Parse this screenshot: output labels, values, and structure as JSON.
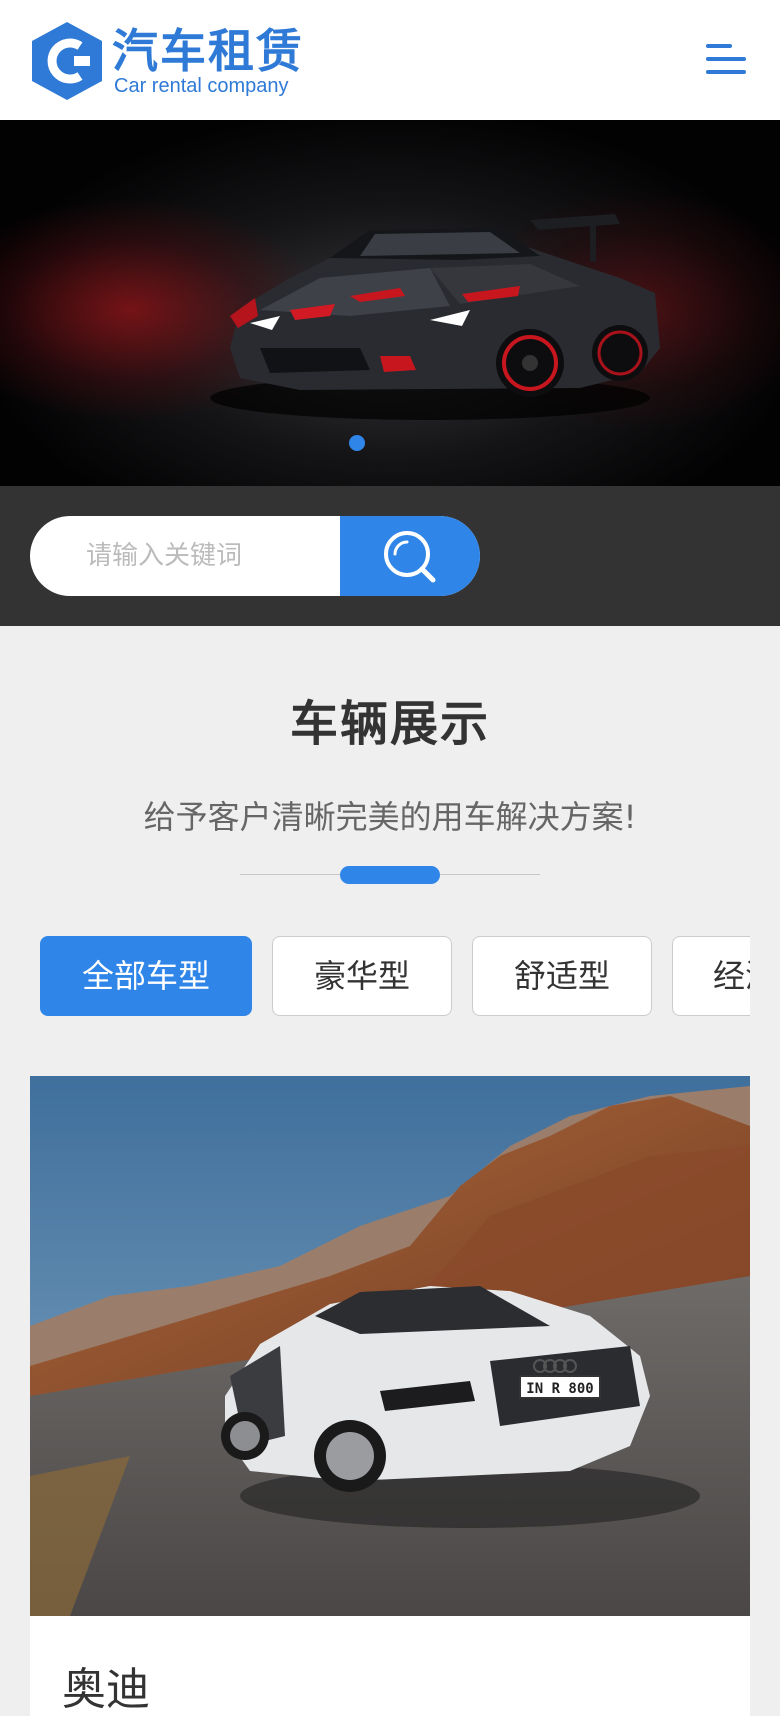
{
  "header": {
    "brand_title": "汽车租赁",
    "brand_subtitle": "Car rental company",
    "logo_letter": "C",
    "menu_icon": "menu-icon"
  },
  "banner": {
    "slide_count": 1,
    "active_slide": 1
  },
  "search": {
    "placeholder": "请输入关键词",
    "value": "",
    "button_icon": "search-icon"
  },
  "section": {
    "title": "车辆展示",
    "subtitle": "给予客户清晰完美的用车解决方案!"
  },
  "tabs": [
    {
      "label": "全部车型",
      "active": true
    },
    {
      "label": "豪华型",
      "active": false
    },
    {
      "label": "舒适型",
      "active": false
    },
    {
      "label": "经济型",
      "active": false
    }
  ],
  "products": [
    {
      "title": "奥迪"
    }
  ],
  "colors": {
    "accent": "#2f86e8",
    "brand": "#2f7ad6",
    "search_bar_bg": "#333333",
    "page_bg": "#efefef"
  }
}
